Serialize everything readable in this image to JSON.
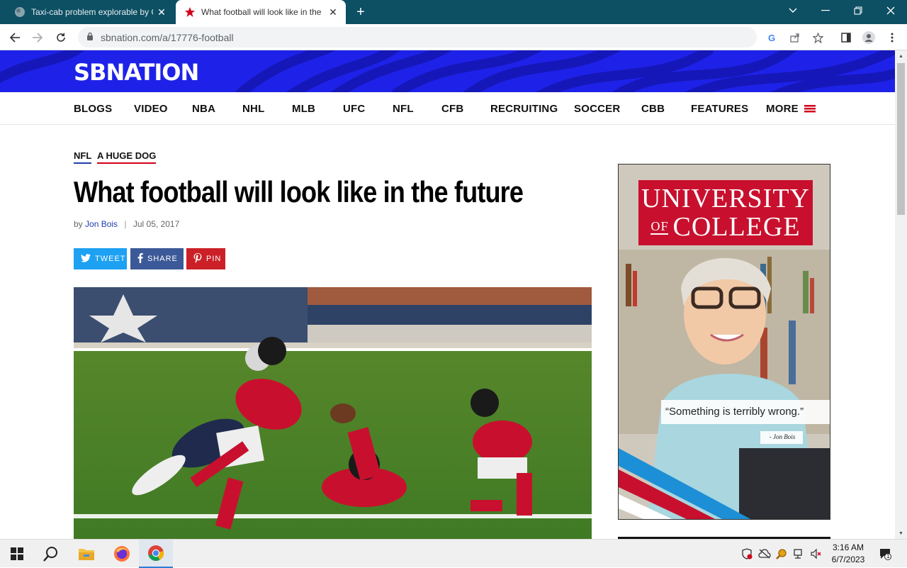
{
  "browser": {
    "tabs": [
      {
        "title": "Taxi-cab problem explorable by G",
        "active": false
      },
      {
        "title": "What football will look like in the",
        "active": true
      }
    ],
    "url": "sbnation.com/a/17776-football"
  },
  "site": {
    "logo": "SBNATION",
    "nav": [
      "BLOGS",
      "VIDEO",
      "NBA",
      "NHL",
      "MLB",
      "UFC",
      "NFL",
      "CFB",
      "RECRUITING",
      "SOCCER",
      "CBB",
      "FEATURES",
      "MORE"
    ]
  },
  "article": {
    "tags": [
      {
        "label": "NFL",
        "color": "#1e3fae"
      },
      {
        "label": "A HUGE DOG",
        "color": "#d0021b"
      }
    ],
    "headline": "What football will look like in the future",
    "by": "by",
    "author": "Jon Bois",
    "date": "Jul 05, 2017",
    "share": {
      "tweet": "TWEET",
      "share": "SHARE",
      "pin": "PIN"
    }
  },
  "ad": {
    "title_line1": "UNIVERSITY",
    "title_of": "OF",
    "title_line2": "COLLEGE",
    "quote": "“Something is terribly wrong.”",
    "attribution": "- Jon Bois"
  },
  "taskbar": {
    "time": "3:16 AM",
    "date": "6/7/2023",
    "notification_count": "1"
  },
  "colors": {
    "brand_blue": "#1e22e8",
    "tabstrip": "#0d4f63",
    "twitter": "#1da1f2",
    "facebook": "#3b5998",
    "pinterest": "#cb2027",
    "falcons_red": "#c8102e"
  }
}
